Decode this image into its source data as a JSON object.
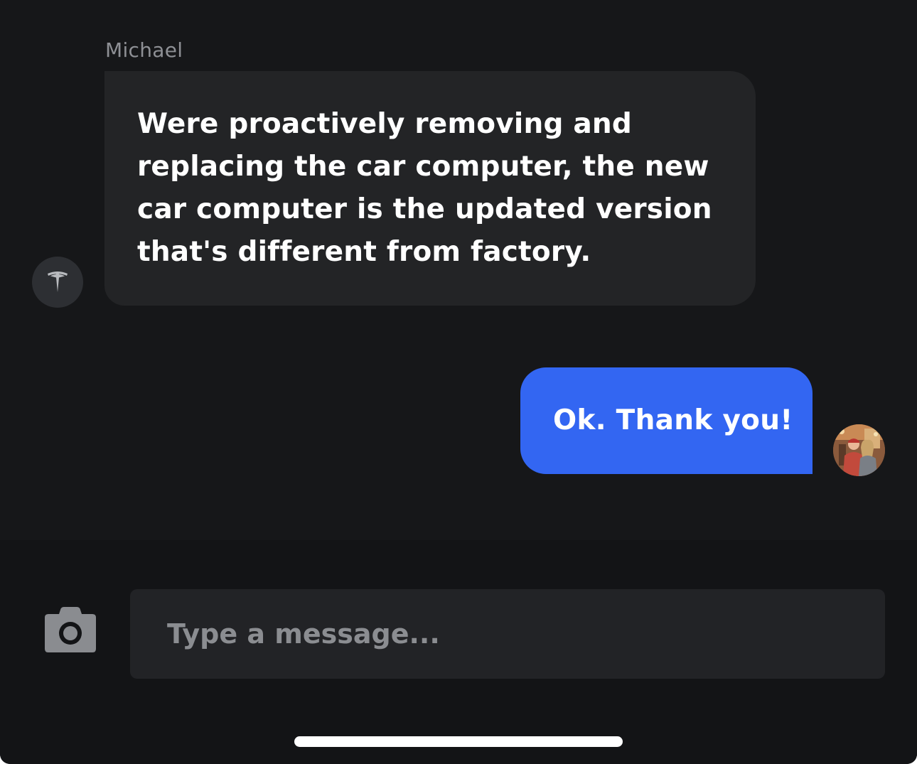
{
  "conversation": {
    "incoming": {
      "sender_name": "Michael",
      "avatar_icon": "tesla-logo-icon",
      "text": "Were proactively removing and replacing the car computer, the new car computer is the updated version that's different from factory."
    },
    "outgoing": {
      "text": "Ok. Thank you!",
      "avatar_icon": "user-photo-avatar"
    }
  },
  "composer": {
    "camera_icon": "camera-icon",
    "placeholder": "Type a message..."
  },
  "colors": {
    "background": "#161719",
    "incoming_bubble": "#232426",
    "outgoing_bubble": "#3366f2",
    "input_field": "#222326"
  }
}
